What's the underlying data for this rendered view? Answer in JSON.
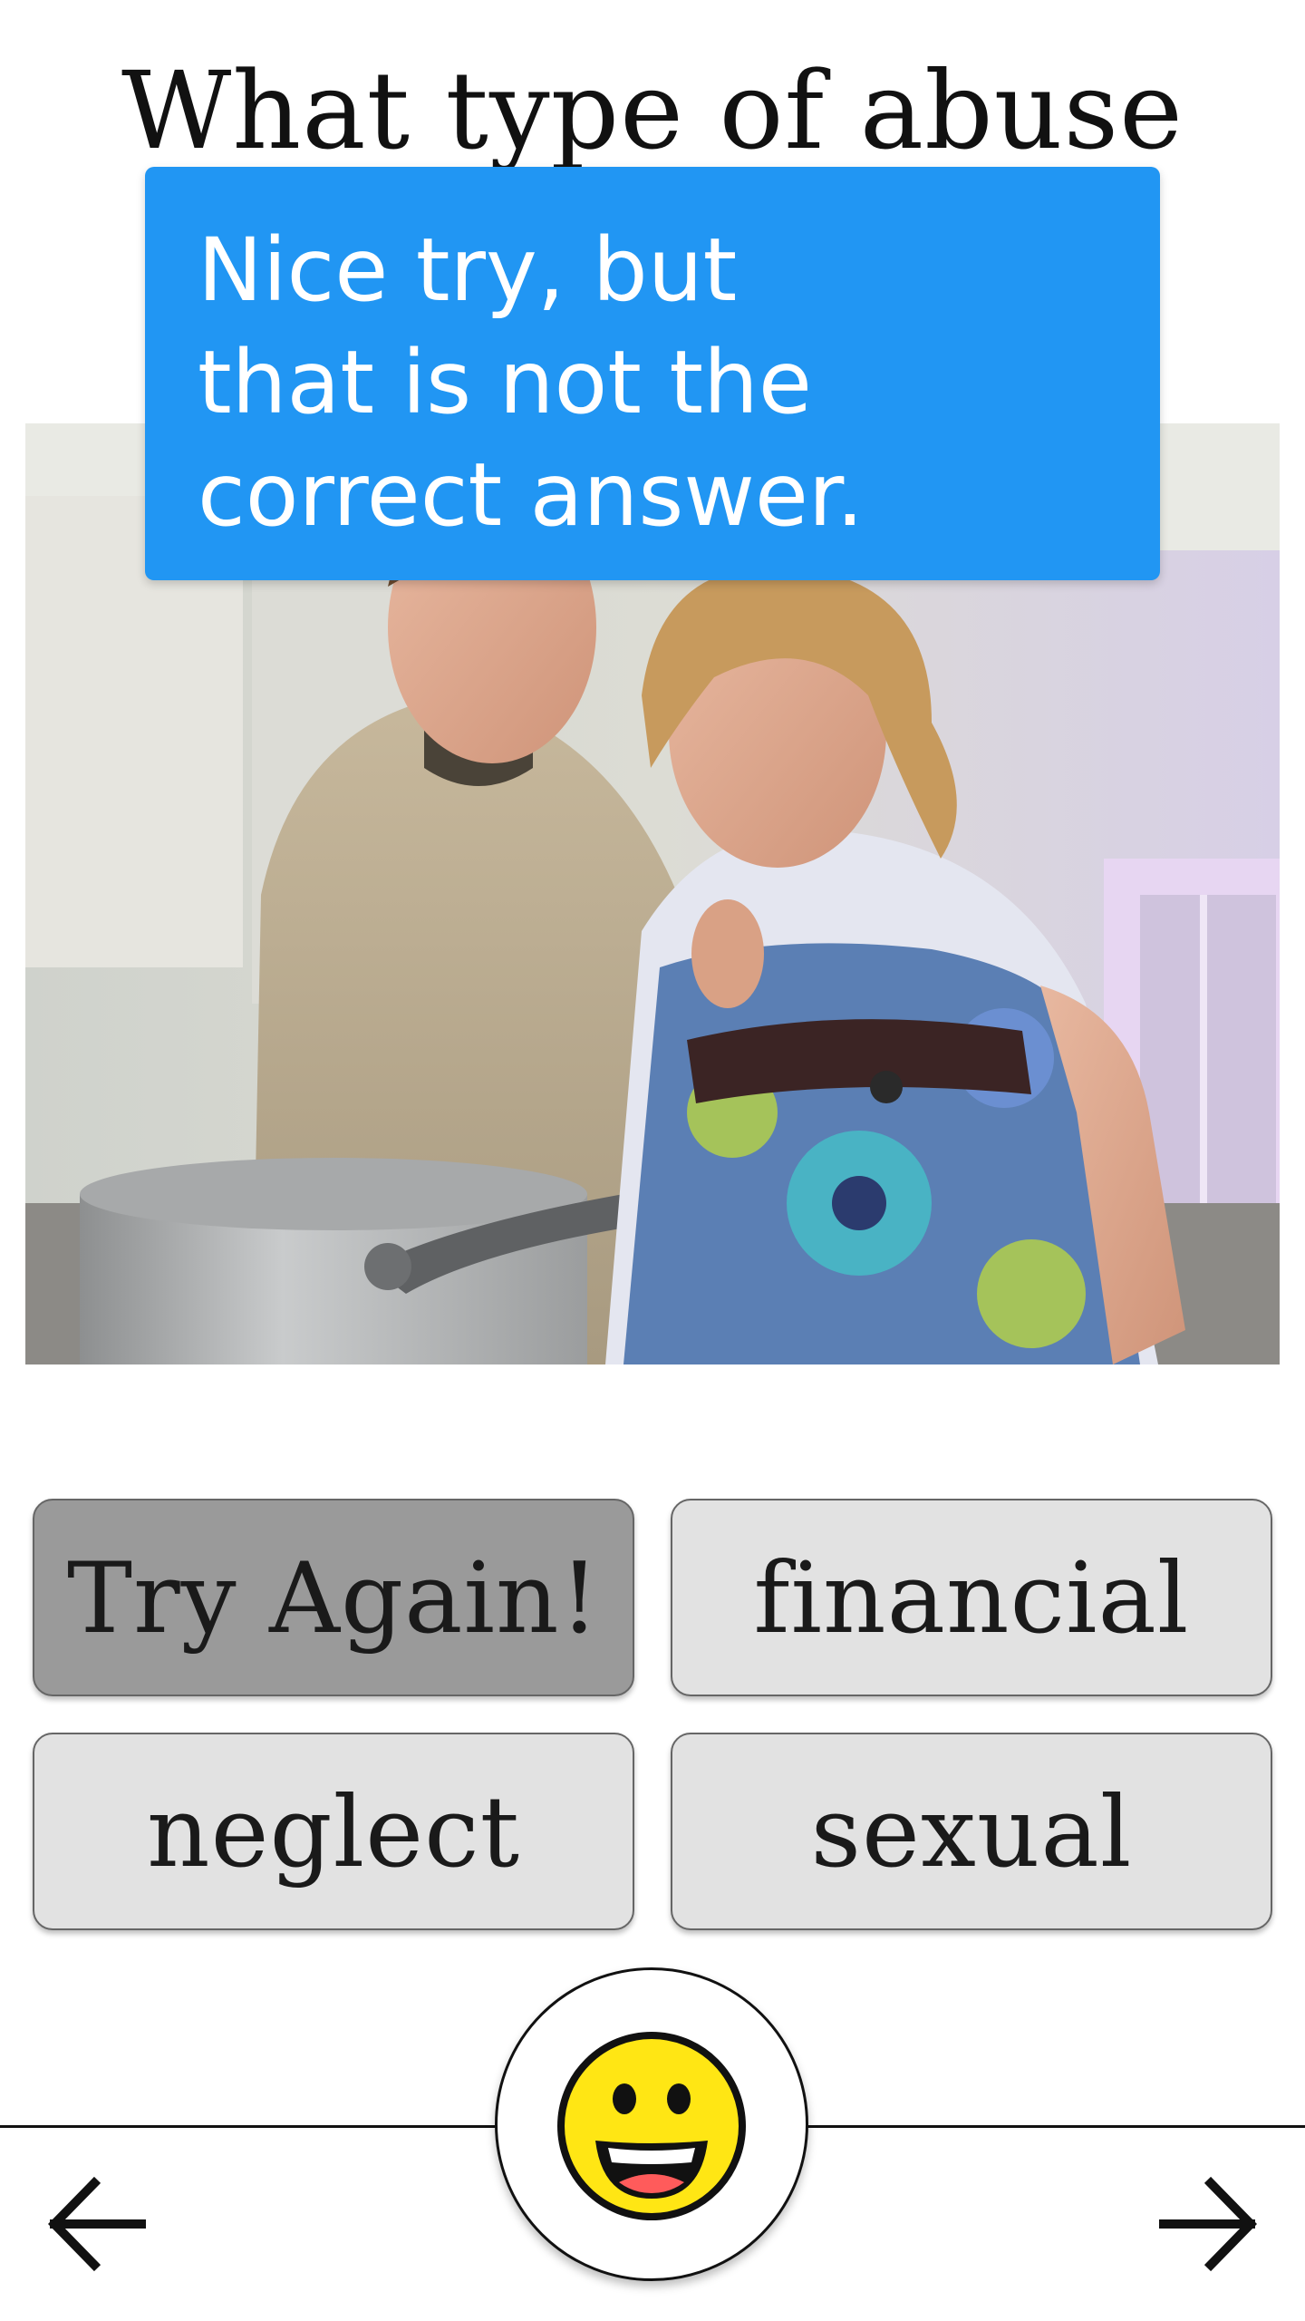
{
  "question": {
    "title": "What type of abuse"
  },
  "feedback": {
    "message": "Nice try, but that is not the correct answer.",
    "background_color": "#2196f3"
  },
  "photo": {
    "subject": "kitchen-scene-photo"
  },
  "answers": [
    {
      "label": "Try Again!",
      "state": "pressed"
    },
    {
      "label": "financial",
      "state": "default"
    },
    {
      "label": "neglect",
      "state": "default"
    },
    {
      "label": "sexual",
      "state": "default"
    }
  ],
  "footer": {
    "prev_icon": "arrow-left-icon",
    "next_icon": "arrow-right-icon",
    "center_icon": "smiley-face-icon",
    "emoji_color": "#ffe614"
  }
}
